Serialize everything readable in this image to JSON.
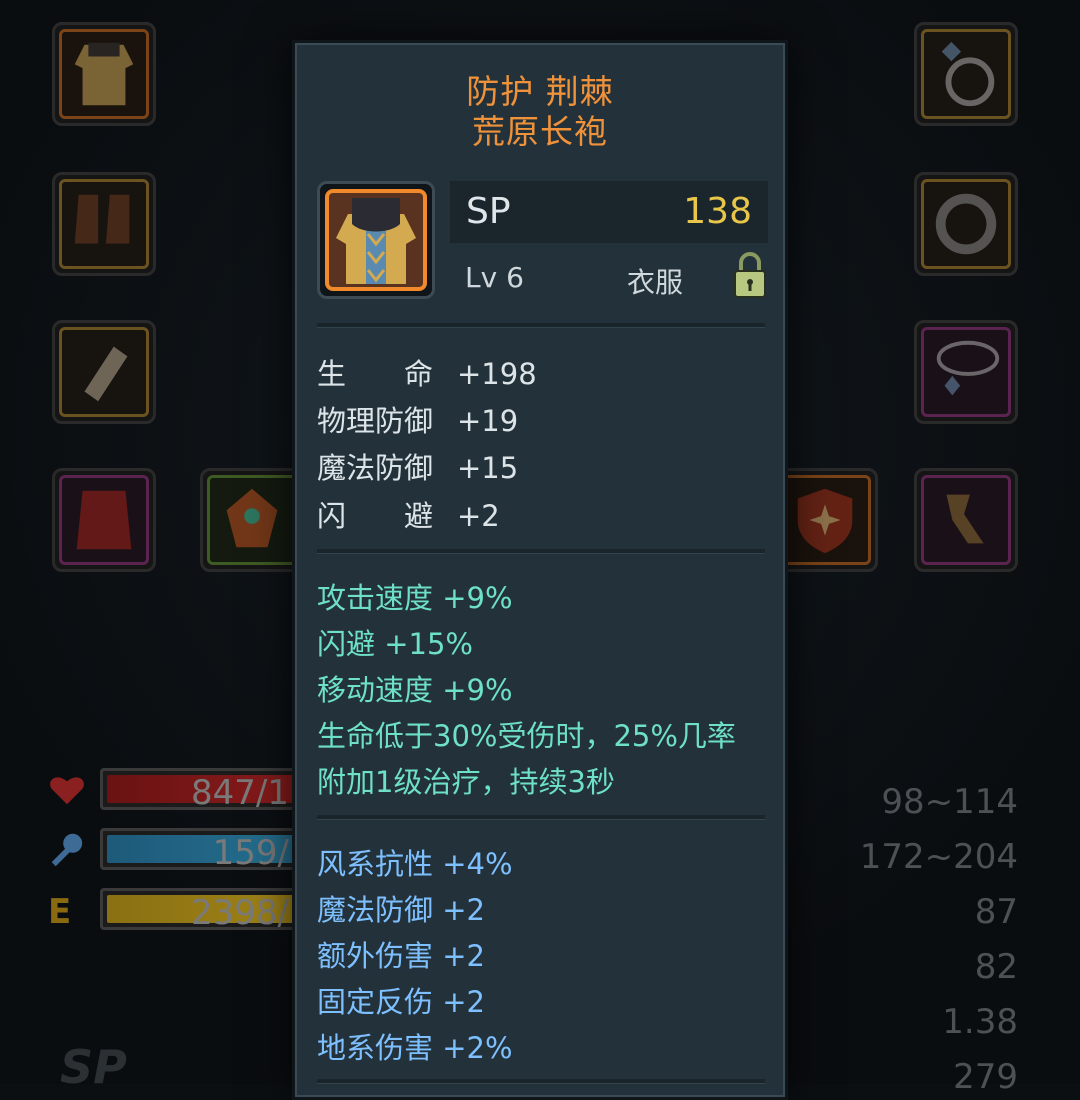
{
  "item": {
    "title_line1": "防护 荆棘",
    "title_line2": "荒原长袍",
    "sp_label": "SP",
    "sp_value": "138",
    "level": "Lv 6",
    "category": "衣服",
    "lock_icon": "lock-icon"
  },
  "base_stats": [
    {
      "name": "生　　命",
      "value": "+198"
    },
    {
      "name": "物理防御",
      "value": "+19"
    },
    {
      "name": "魔法防御",
      "value": "+15"
    },
    {
      "name": "闪　　避",
      "value": "+2"
    }
  ],
  "special_stats": [
    "攻击速度 +9%",
    "闪避 +15%",
    "移动速度 +9%",
    "生命低于30%受伤时，25%几率",
    "附加1级治疗，持续3秒"
  ],
  "extra_stats": [
    "风系抗性 +4%",
    "魔法防御 +2",
    "额外伤害 +2",
    "固定反伤 +2",
    "地系伤害 +2%"
  ],
  "status_bars": {
    "hp_text": "847/1",
    "mp_text": "159/",
    "exp_text": "2398/"
  },
  "right_values": [
    "98~114",
    "172~204",
    "87",
    "82",
    "1.38",
    "279"
  ],
  "corner_label": "SP",
  "colors": {
    "title": "#f0923a",
    "sp_value": "#e8c64a",
    "green_text": "#6ee0c8",
    "blue_text": "#7ec0ff",
    "panel_bg": "#23323a"
  }
}
